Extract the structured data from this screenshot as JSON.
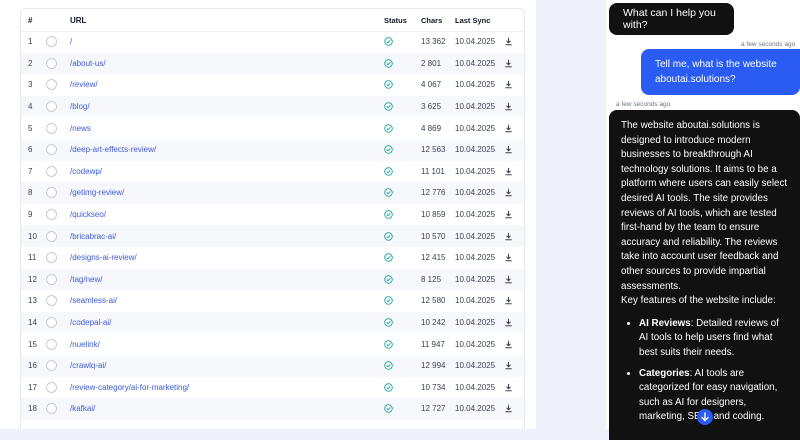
{
  "table": {
    "headers": {
      "num": "#",
      "url": "URL",
      "status": "Status",
      "chars": "Chars",
      "last_sync": "Last Sync"
    },
    "rows": [
      {
        "num": "1",
        "url": "/",
        "chars": "13 362",
        "last_sync": "10.04.2025"
      },
      {
        "num": "2",
        "url": "/about-us/",
        "chars": "2 801",
        "last_sync": "10.04.2025"
      },
      {
        "num": "3",
        "url": "/review/",
        "chars": "4 067",
        "last_sync": "10.04.2025"
      },
      {
        "num": "4",
        "url": "/blog/",
        "chars": "3 625",
        "last_sync": "10.04.2025"
      },
      {
        "num": "5",
        "url": "/news",
        "chars": "4 869",
        "last_sync": "10.04.2025"
      },
      {
        "num": "6",
        "url": "/deep-art-effects-review/",
        "chars": "12 563",
        "last_sync": "10.04.2025"
      },
      {
        "num": "7",
        "url": "/codewp/",
        "chars": "11 101",
        "last_sync": "10.04.2025"
      },
      {
        "num": "8",
        "url": "/getimg-review/",
        "chars": "12 776",
        "last_sync": "10.04.2025"
      },
      {
        "num": "9",
        "url": "/quickseo/",
        "chars": "10 859",
        "last_sync": "10.04.2025"
      },
      {
        "num": "10",
        "url": "/bricabrac-ai/",
        "chars": "10 570",
        "last_sync": "10.04.2025"
      },
      {
        "num": "11",
        "url": "/designs-ai-review/",
        "chars": "12 415",
        "last_sync": "10.04.2025"
      },
      {
        "num": "12",
        "url": "/tag/new/",
        "chars": "8 125",
        "last_sync": "10.04.2025"
      },
      {
        "num": "13",
        "url": "/seamless-ai/",
        "chars": "12 580",
        "last_sync": "10.04.2025"
      },
      {
        "num": "14",
        "url": "/codepal-ai/",
        "chars": "10 242",
        "last_sync": "10.04.2025"
      },
      {
        "num": "15",
        "url": "/nuelink/",
        "chars": "11 947",
        "last_sync": "10.04.2025"
      },
      {
        "num": "16",
        "url": "/crawlq-ai/",
        "chars": "12 994",
        "last_sync": "10.04.2025"
      },
      {
        "num": "17",
        "url": "/review-category/ai-for-marketing/",
        "chars": "10 734",
        "last_sync": "10.04.2025"
      },
      {
        "num": "18",
        "url": "/kafkai/",
        "chars": "12 727",
        "last_sync": "10.04.2025"
      }
    ]
  },
  "chat": {
    "greeting": "What can I help you with?",
    "user_time": "a few seconds ago",
    "user_message": "Tell me, what is the website aboutai.solutions?",
    "ai_time": "a few seconds ago",
    "ai_intro": "The website aboutai.solutions is designed to introduce modern businesses to breakthrough AI technology solutions. It aims to be a platform where users can easily select desired AI tools. The site provides reviews of AI tools, which are tested first-hand by the team to ensure accuracy and reliability. The reviews take into account user feedback and other sources to provide impartial assessments.",
    "ai_features_lead": "Key features of the website include:",
    "features": [
      {
        "title": "AI Reviews",
        "text": ": Detailed reviews of AI tools to help users find what best suits their needs."
      },
      {
        "title": "Categories",
        "text": ": AI tools are categorized for easy navigation, such as AI for designers, marketing, SEO, and coding."
      }
    ]
  },
  "colors": {
    "accent": "#2a5bf2",
    "status_ok": "#16a39a",
    "link": "#3b5bdb"
  },
  "icons": {
    "status": "check-circle-icon",
    "download": "download-icon",
    "scroll": "arrow-down-icon"
  }
}
